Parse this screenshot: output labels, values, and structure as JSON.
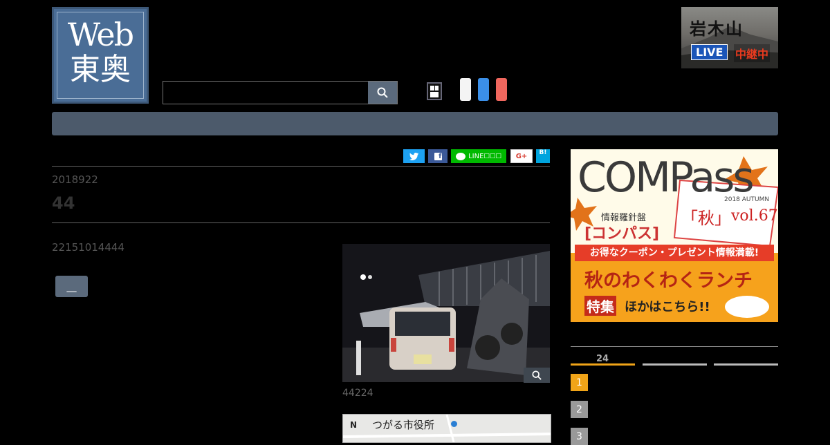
{
  "header": {
    "logo_line1": "Web",
    "logo_line2": "東奥",
    "search_placeholder": "",
    "search_value": "",
    "live_banner": {
      "title": "岩木山",
      "live": "LIVE",
      "status": "中継中"
    }
  },
  "article": {
    "share": {
      "twitter": "",
      "facebook": "",
      "line": "LINE",
      "gplus": "G+",
      "hatena": "B!"
    },
    "date": "2018922",
    "title": "44",
    "body": "22151014444",
    "more_button": "__",
    "photo_caption": "44224",
    "map_label": "つがる市役所"
  },
  "sidebar": {
    "ad": {
      "title": "COMPass",
      "tagline": "情報羅針盤",
      "brand_jp": "[コンパス]",
      "season": "「秋」",
      "season_year": "2018 AUTUMN",
      "volume": "vol.67",
      "coupon": "お得なクーポン・プレゼント情報満載!",
      "feature": "秋のわくわくランチ",
      "feature_sub_1": "特集",
      "feature_sub_2": "ほかはこちら!!"
    },
    "ranking": {
      "tabs": [
        {
          "label": "24",
          "active": true
        },
        {
          "label": "",
          "active": false
        },
        {
          "label": "",
          "active": false
        }
      ],
      "items": [
        "1",
        "2",
        "3"
      ]
    }
  },
  "colors": {
    "accent": "#f0a418",
    "nav": "#4c5a6b",
    "twitter": "#1da1f2",
    "facebook": "#3b5998",
    "line": "#00b900",
    "hatena": "#00a4de"
  }
}
